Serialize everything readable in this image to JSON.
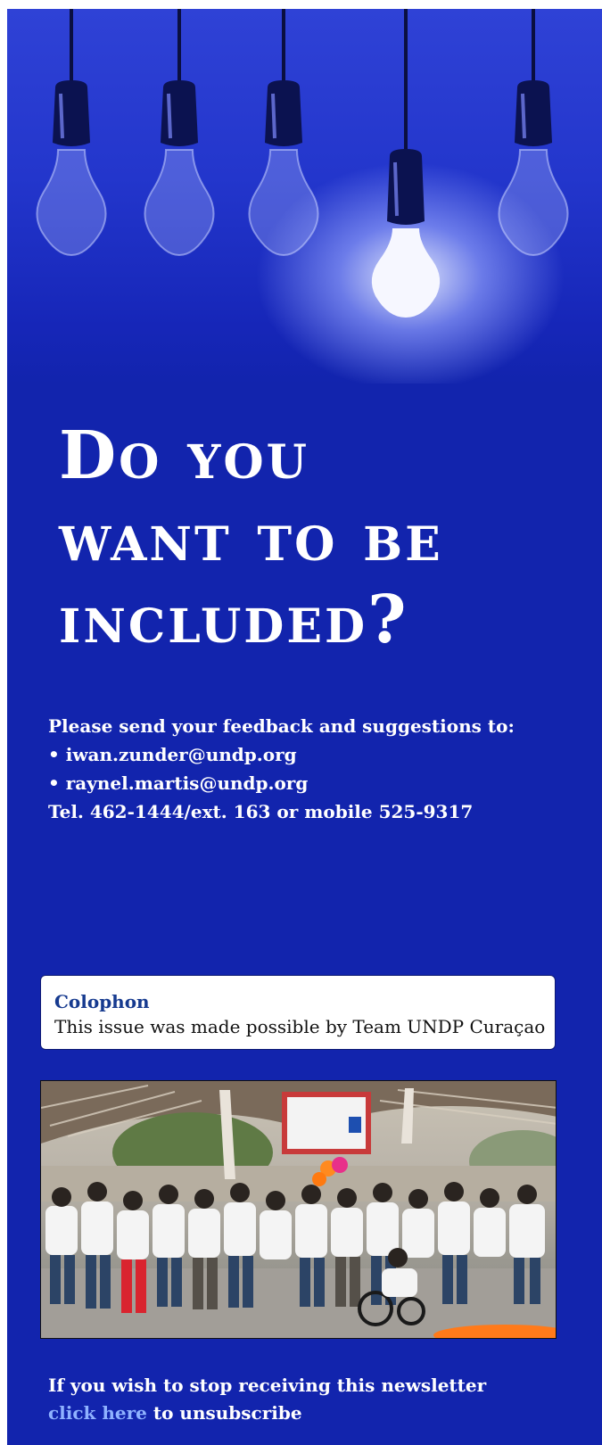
{
  "headline": {
    "line1": "Do you",
    "line2": "want to be",
    "line3": "included?"
  },
  "contact": {
    "intro": "Please send your feedback and suggestions to:",
    "emails": [
      "• iwan.zunder@undp.org",
      "• raynel.martis@undp.org"
    ],
    "phone": "Tel. 462-1444/ext. 163 or mobile 525-9317"
  },
  "colophon": {
    "title": "Colophon",
    "text": "This issue was made possible by Team UNDP Curaçao"
  },
  "unsubscribe": {
    "line1": "If you wish to stop receiving this newsletter",
    "link": "click here",
    "rest": " to unsubscribe"
  },
  "colors": {
    "panel": "#1224ad",
    "link": "#8fb2ff",
    "colophon_title": "#163a8f"
  },
  "icons": [
    "light-bulb-icon"
  ]
}
